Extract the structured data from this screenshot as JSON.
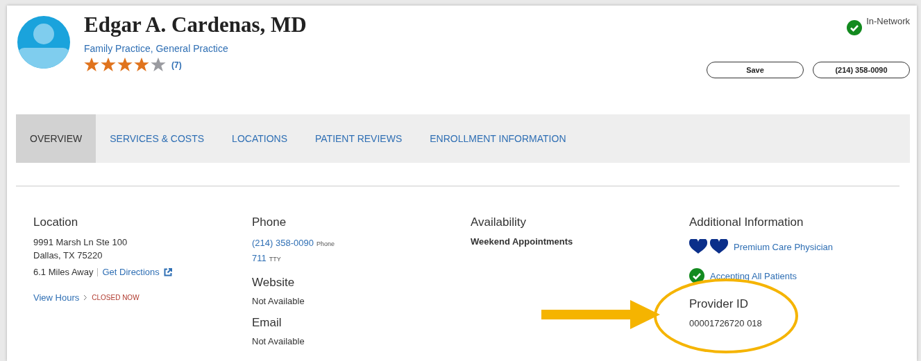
{
  "provider": {
    "name": "Edgar A. Cardenas, MD",
    "specialty": "Family Practice, General Practice",
    "stars": 4,
    "review_count": "(7)",
    "network_status": "In-Network"
  },
  "actions": [
    {
      "label": "Save"
    },
    {
      "label": "(214) 358-0090"
    }
  ],
  "tabs": [
    {
      "label": "OVERVIEW",
      "selected": true
    },
    {
      "label": "SERVICES & COSTS",
      "selected": false
    },
    {
      "label": "LOCATIONS",
      "selected": false
    },
    {
      "label": "PATIENT REVIEWS",
      "selected": false
    },
    {
      "label": "ENROLLMENT INFORMATION",
      "selected": false
    }
  ],
  "location": {
    "heading": "Location",
    "address_lines": [
      "9991 Marsh Ln Ste 100",
      "Dallas, TX 75220"
    ],
    "distance": "6.1 Miles Away",
    "directions_link": "Get Directions",
    "hours_link": "View Hours",
    "hours_status": "CLOSED NOW"
  },
  "phone": {
    "heading": "Phone",
    "numbers": [
      {
        "number": "(214) 358-0090",
        "type": "Phone"
      },
      {
        "number": "711",
        "type": "TTY"
      }
    ]
  },
  "website": {
    "heading": "Website",
    "value": "Not Available"
  },
  "email": {
    "heading": "Email",
    "value": "Not Available"
  },
  "availability": {
    "heading": "Availability",
    "value": "Weekend Appointments"
  },
  "additional_information": {
    "heading": "Additional Information",
    "items": [
      {
        "kind": "hearts",
        "label": "Premium Care Physician"
      },
      {
        "kind": "check",
        "label": "Accepting All Patients"
      }
    ]
  },
  "provider_id": {
    "heading": "Provider ID",
    "value": "00001726720 018"
  }
}
